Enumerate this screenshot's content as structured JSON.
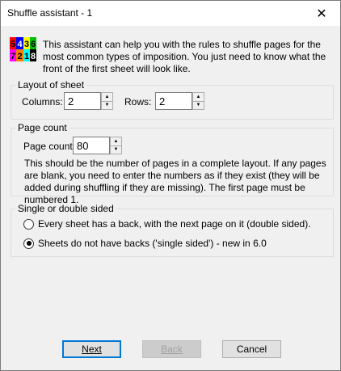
{
  "window": {
    "title": "Shuffle assistant - 1"
  },
  "intro": {
    "icon_digits": [
      [
        "5",
        "4",
        "3",
        "6"
      ],
      [
        "7",
        "2",
        "1",
        "8"
      ]
    ],
    "text": "This assistant can help you with the rules to shuffle pages for the most common types of imposition. You just need to know what the front of the first sheet will look like."
  },
  "layout": {
    "group_label": "Layout of sheet",
    "columns_label": "Columns:",
    "columns_value": "2",
    "rows_label": "Rows:",
    "rows_value": "2"
  },
  "page_count": {
    "group_label": "Page count",
    "label": "Page count",
    "value": "80",
    "description": "This should be the number of pages in a complete layout. If any pages are blank, you need to enter the numbers as if they exist (they will be added during shuffling if they are missing). The first page must be numbered 1."
  },
  "sided": {
    "group_label": "Single or double sided",
    "options": [
      {
        "label": "Every sheet has a back, with the next page on it (double sided).",
        "selected": false
      },
      {
        "label": "Sheets do not have backs ('single sided') - new in 6.0",
        "selected": true
      }
    ]
  },
  "buttons": {
    "next": "Next",
    "back": "Back",
    "cancel": "Cancel"
  }
}
